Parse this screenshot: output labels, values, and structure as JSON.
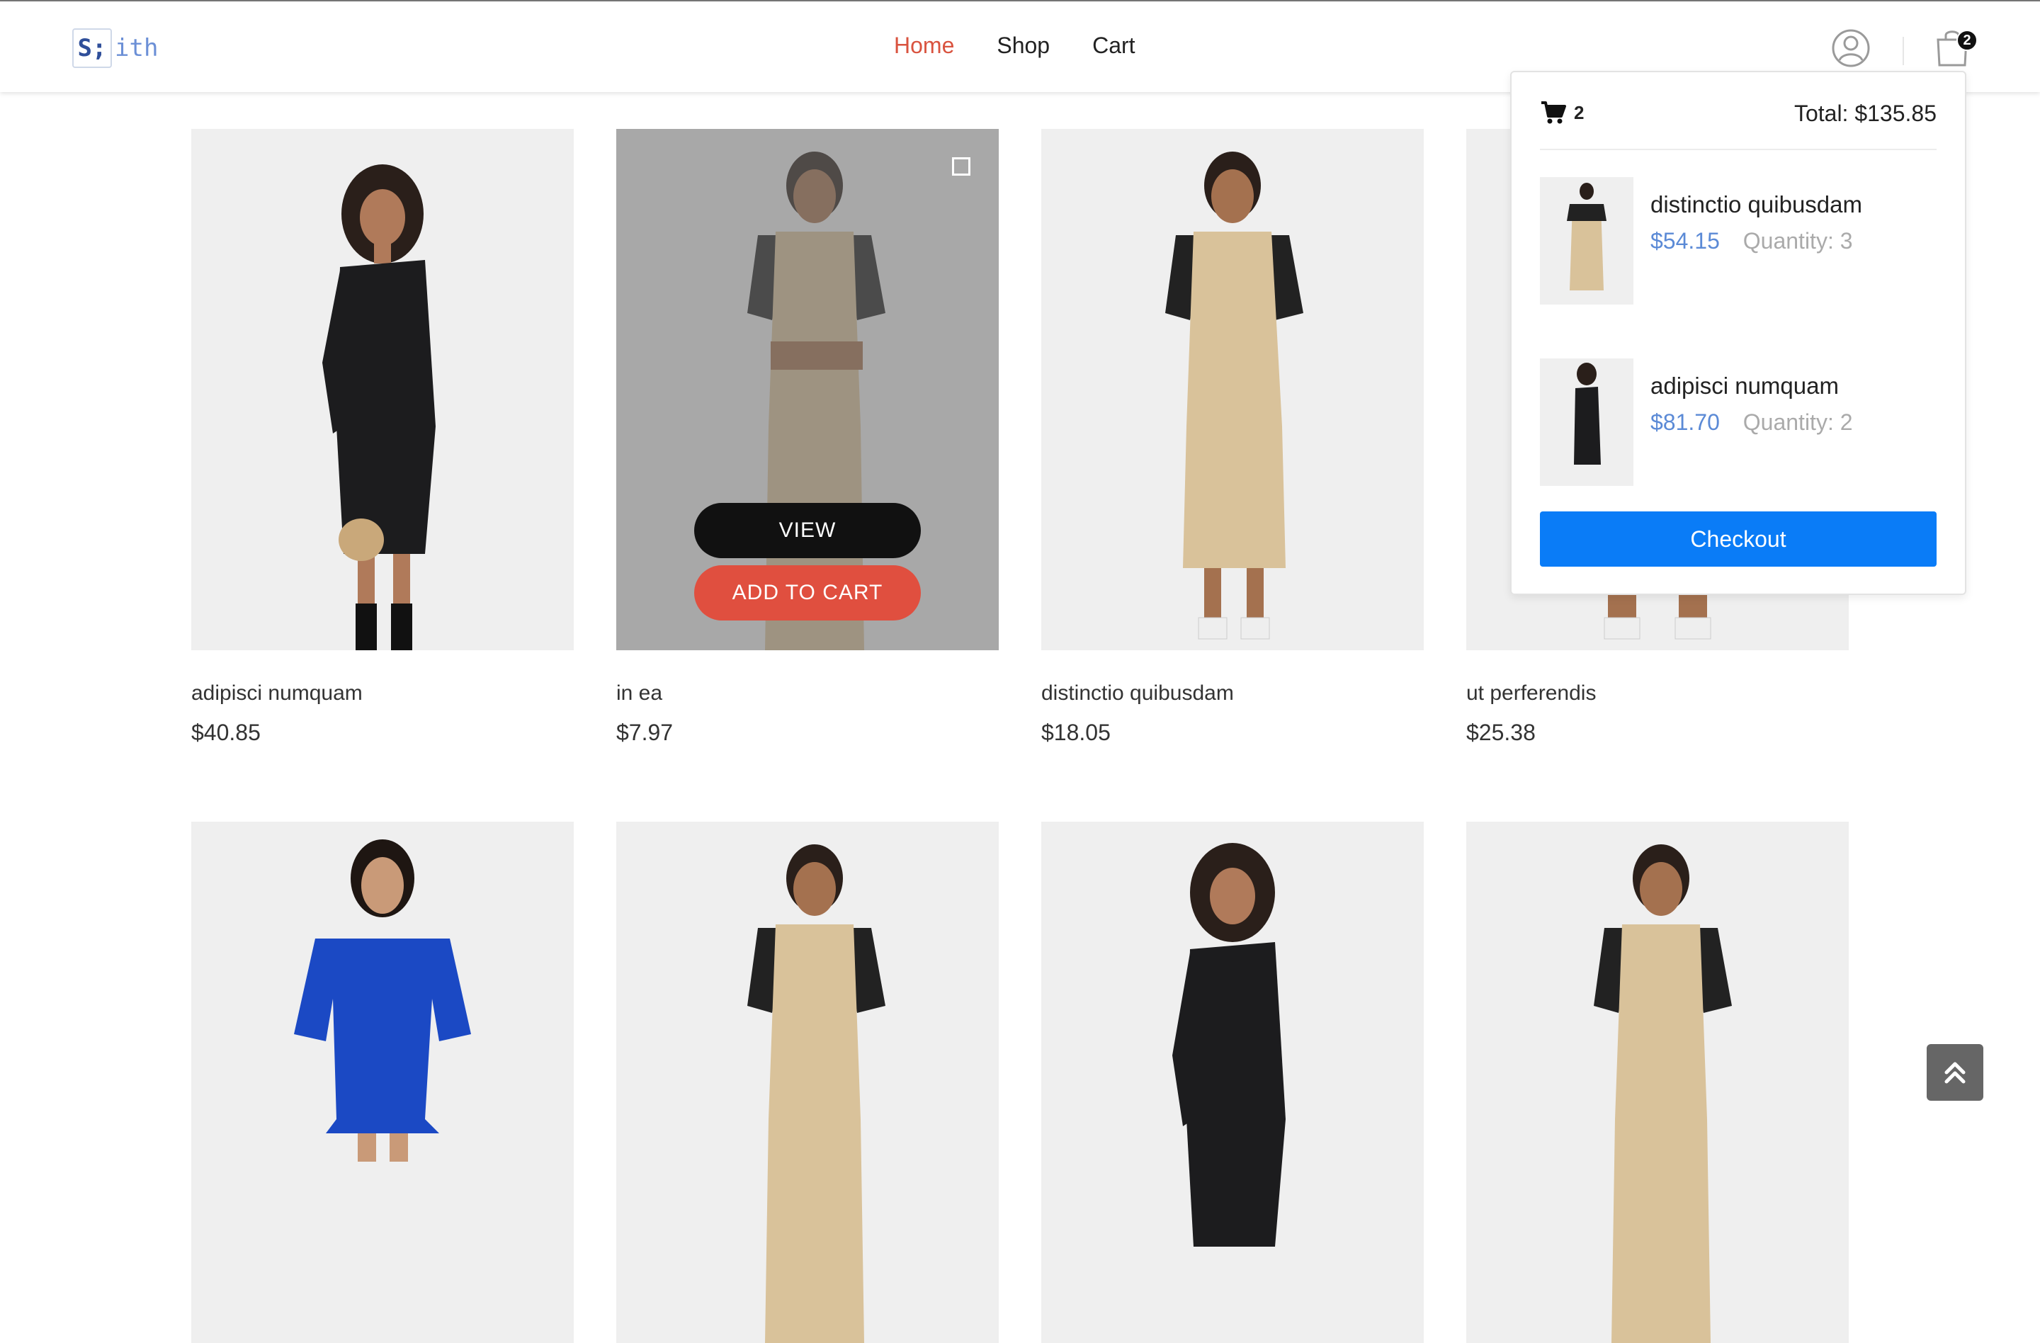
{
  "brand": {
    "logo_box": "S;",
    "logo_text": "ith"
  },
  "nav": {
    "items": [
      "Home",
      "Shop",
      "Cart"
    ]
  },
  "cart": {
    "badge_count": "2",
    "count": "2",
    "total_label": "Total: $135.85",
    "items": [
      {
        "title": "distinctio quibusdam",
        "price": "$54.15",
        "quantity": "Quantity: 3"
      },
      {
        "title": "adipisci numquam",
        "price": "$81.70",
        "quantity": "Quantity: 2"
      }
    ],
    "checkout_label": "Checkout"
  },
  "product_actions": {
    "view_label": "VIEW",
    "add_label": "ADD TO CART"
  },
  "products": [
    {
      "name": "adipisci numquam",
      "price": "$40.85"
    },
    {
      "name": "in ea",
      "price": "$7.97"
    },
    {
      "name": "distinctio quibusdam",
      "price": "$18.05"
    },
    {
      "name": "ut perferendis",
      "price": "$25.38"
    }
  ],
  "colors": {
    "nav_active": "#d9533f",
    "add_to_cart": "#e04f3f",
    "checkout": "#0a7cf7",
    "cart_price": "#5b8ad6"
  },
  "icons": {
    "user": "user-circle-icon",
    "bag": "shopping-bag-icon",
    "cart": "shopping-cart-icon",
    "scroll_top": "double-chevron-up-icon"
  }
}
